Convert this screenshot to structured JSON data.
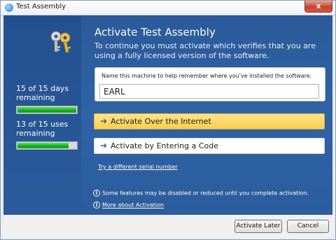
{
  "window": {
    "title": "Test Assembly",
    "close_glyph": "x"
  },
  "sidebar": {
    "days_status": "15 of 15 days remaining",
    "days_progress": 1.0,
    "uses_status": "13 of 15 uses remaining",
    "uses_progress": 0.8667
  },
  "main": {
    "heading": "Activate Test Assembly",
    "description": "To continue you must activate which verifies that you are using a fully licensed version of the software.",
    "machine_name": {
      "label": "Name this machine to help remember where you've installed the software.",
      "value": "EARL"
    },
    "actions": [
      {
        "label": "Activate Over the Internet",
        "arrow": "➔"
      },
      {
        "label": "Activate by Entering a Code",
        "arrow": "➔"
      }
    ],
    "serial_link": "Try a different serial number",
    "info_notice": "Some features may be disabled or reduced until you complete activation.",
    "info_link": "More about Activation",
    "info_glyph": "i"
  },
  "footer": {
    "activate_later": "Activate Later",
    "cancel": "Cancel"
  },
  "colors": {
    "accent_blue": "#2d5c9c",
    "highlight_yellow": "#f9cf4a",
    "progress_green": "#13b41e"
  }
}
